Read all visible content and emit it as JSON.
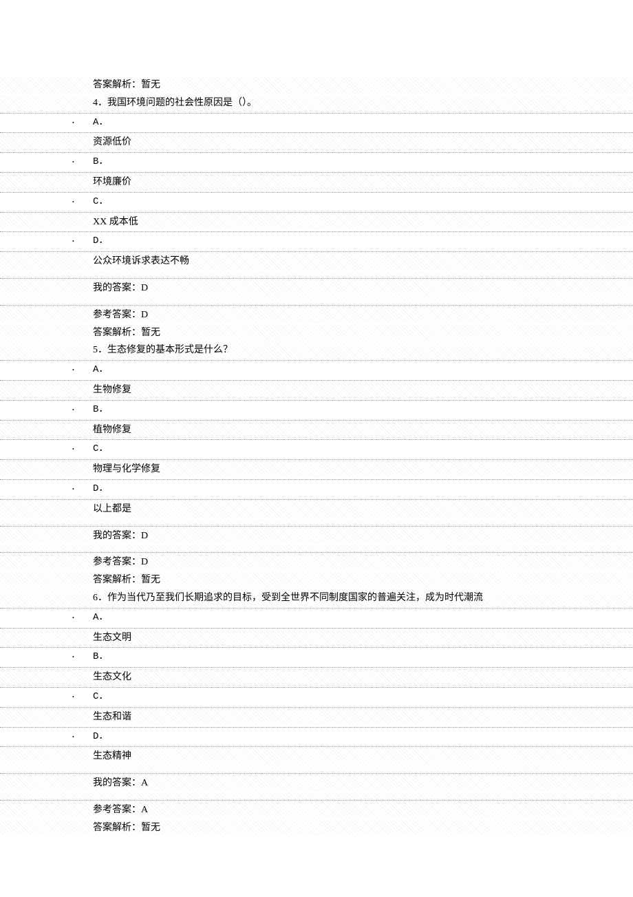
{
  "q3_trail": {
    "analysis": "答案解析：暂无"
  },
  "q4": {
    "stem": "4．我国环境问题的社会性原因是（）。",
    "options": {
      "a_letter": "A．",
      "a_text": "资源低价",
      "b_letter": "B．",
      "b_text": "环境廉价",
      "c_letter": "C．",
      "c_text": "XX 成本低",
      "d_letter": "D．",
      "d_text": "公众环境诉求表达不畅"
    },
    "my_answer": "我的答案：D",
    "ref_answer": "参考答案：D",
    "analysis": "答案解析：暂无"
  },
  "q5": {
    "stem": "5．生态修复的基本形式是什么？",
    "options": {
      "a_letter": "A．",
      "a_text": "生物修复",
      "b_letter": "B．",
      "b_text": "植物修复",
      "c_letter": "C．",
      "c_text": "物理与化学修复",
      "d_letter": "D．",
      "d_text": "以上都是"
    },
    "my_answer": "我的答案：D",
    "ref_answer": "参考答案：D",
    "analysis": "答案解析：暂无"
  },
  "q6": {
    "stem": "6．作为当代乃至我们长期追求的目标，受到全世界不同制度国家的普遍关注，成为时代潮流",
    "options": {
      "a_letter": "A．",
      "a_text": "生态文明",
      "b_letter": "B．",
      "b_text": "生态文化",
      "c_letter": "C．",
      "c_text": "生态和谐",
      "d_letter": "D．",
      "d_text": "生态精神"
    },
    "my_answer": "我的答案：A",
    "ref_answer": "参考答案：A",
    "analysis": "答案解析：暂无"
  }
}
